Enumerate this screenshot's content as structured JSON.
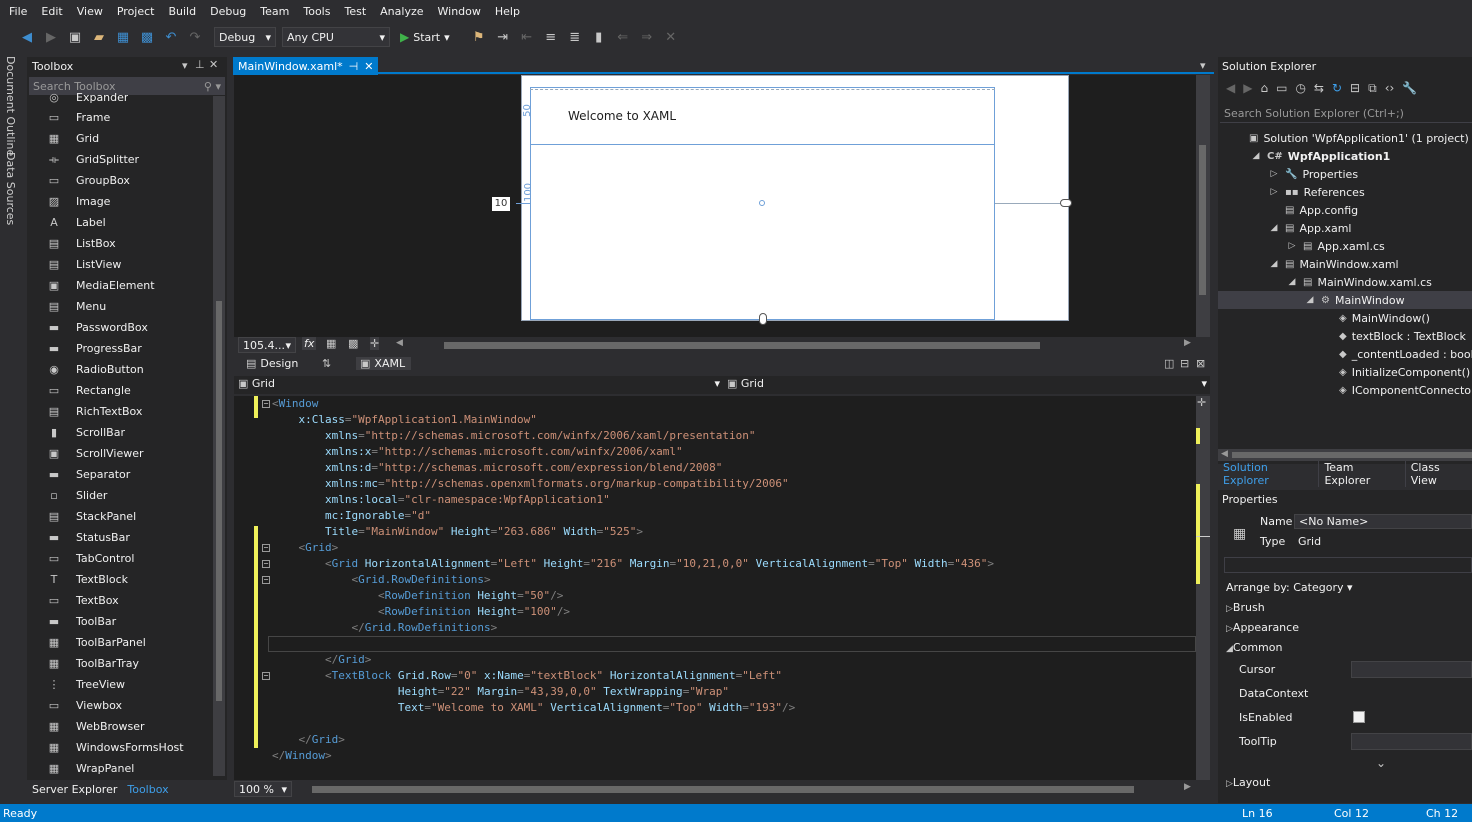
{
  "menu": [
    "File",
    "Edit",
    "View",
    "Project",
    "Build",
    "Debug",
    "Team",
    "Tools",
    "Test",
    "Analyze",
    "Window",
    "Help"
  ],
  "toolbar": {
    "config": "Debug",
    "platform": "Any CPU",
    "start": "Start"
  },
  "left_vtabs": [
    "Document Outline",
    "Data Sources"
  ],
  "toolbox": {
    "title": "Toolbox",
    "search": "Search Toolbox",
    "partial": "Expander",
    "items": [
      "Frame",
      "Grid",
      "GridSplitter",
      "GroupBox",
      "Image",
      "Label",
      "ListBox",
      "ListView",
      "MediaElement",
      "Menu",
      "PasswordBox",
      "ProgressBar",
      "RadioButton",
      "Rectangle",
      "RichTextBox",
      "ScrollBar",
      "ScrollViewer",
      "Separator",
      "Slider",
      "StackPanel",
      "StatusBar",
      "TabControl",
      "TextBlock",
      "TextBox",
      "ToolBar",
      "ToolBarPanel",
      "ToolBarTray",
      "TreeView",
      "Viewbox",
      "WebBrowser",
      "WindowsFormsHost",
      "WrapPanel"
    ],
    "bottom_tabs": [
      "Server Explorer",
      "Toolbox"
    ]
  },
  "doc_tab": {
    "label": "MainWindow.xaml*"
  },
  "designer": {
    "textblock": "Welcome to XAML",
    "row1": "50",
    "row2": "100",
    "margin_left": "10",
    "zoom": "105.4...",
    "fx": "fx"
  },
  "split": {
    "design": "Design",
    "xaml": "XAML",
    "arrows": "⇅"
  },
  "nav": {
    "left": "Grid",
    "right": "Grid"
  },
  "code_zoom": "100 %",
  "code": [
    [
      [
        "br",
        "<"
      ],
      [
        "tag",
        "Window"
      ]
    ],
    [
      [
        "txt",
        "    "
      ],
      [
        "attr",
        "x:Class"
      ],
      [
        "br",
        "="
      ],
      [
        "val",
        "\"WpfApplication1.MainWindow\""
      ]
    ],
    [
      [
        "txt",
        "        "
      ],
      [
        "attr",
        "xmlns"
      ],
      [
        "br",
        "="
      ],
      [
        "val",
        "\"http://schemas.microsoft.com/winfx/2006/xaml/presentation\""
      ]
    ],
    [
      [
        "txt",
        "        "
      ],
      [
        "attr",
        "xmlns:x"
      ],
      [
        "br",
        "="
      ],
      [
        "val",
        "\"http://schemas.microsoft.com/winfx/2006/xaml\""
      ]
    ],
    [
      [
        "txt",
        "        "
      ],
      [
        "attr",
        "xmlns:d"
      ],
      [
        "br",
        "="
      ],
      [
        "val",
        "\"http://schemas.microsoft.com/expression/blend/2008\""
      ]
    ],
    [
      [
        "txt",
        "        "
      ],
      [
        "attr",
        "xmlns:mc"
      ],
      [
        "br",
        "="
      ],
      [
        "val",
        "\"http://schemas.openxmlformats.org/markup-compatibility/2006\""
      ]
    ],
    [
      [
        "txt",
        "        "
      ],
      [
        "attr",
        "xmlns:local"
      ],
      [
        "br",
        "="
      ],
      [
        "val",
        "\"clr-namespace:WpfApplication1\""
      ]
    ],
    [
      [
        "txt",
        "        "
      ],
      [
        "attr",
        "mc:Ignorable"
      ],
      [
        "br",
        "="
      ],
      [
        "val",
        "\"d\""
      ]
    ],
    [
      [
        "txt",
        "        "
      ],
      [
        "attr",
        "Title"
      ],
      [
        "br",
        "="
      ],
      [
        "val",
        "\"MainWindow\""
      ],
      [
        "txt",
        " "
      ],
      [
        "attr",
        "Height"
      ],
      [
        "br",
        "="
      ],
      [
        "val",
        "\"263.686\""
      ],
      [
        "txt",
        " "
      ],
      [
        "attr",
        "Width"
      ],
      [
        "br",
        "="
      ],
      [
        "val",
        "\"525\""
      ],
      [
        "br",
        ">"
      ]
    ],
    [
      [
        "txt",
        "    "
      ],
      [
        "br",
        "<"
      ],
      [
        "tag",
        "Grid"
      ],
      [
        "br",
        ">"
      ]
    ],
    [
      [
        "txt",
        "        "
      ],
      [
        "br",
        "<"
      ],
      [
        "tag",
        "Grid"
      ],
      [
        "txt",
        " "
      ],
      [
        "attr",
        "HorizontalAlignment"
      ],
      [
        "br",
        "="
      ],
      [
        "val",
        "\"Left\""
      ],
      [
        "txt",
        " "
      ],
      [
        "attr",
        "Height"
      ],
      [
        "br",
        "="
      ],
      [
        "val",
        "\"216\""
      ],
      [
        "txt",
        " "
      ],
      [
        "attr",
        "Margin"
      ],
      [
        "br",
        "="
      ],
      [
        "val",
        "\"10,21,0,0\""
      ],
      [
        "txt",
        " "
      ],
      [
        "attr",
        "VerticalAlignment"
      ],
      [
        "br",
        "="
      ],
      [
        "val",
        "\"Top\""
      ],
      [
        "txt",
        " "
      ],
      [
        "attr",
        "Width"
      ],
      [
        "br",
        "="
      ],
      [
        "val",
        "\"436\""
      ],
      [
        "br",
        ">"
      ]
    ],
    [
      [
        "txt",
        "            "
      ],
      [
        "br",
        "<"
      ],
      [
        "tag",
        "Grid.RowDefinitions"
      ],
      [
        "br",
        ">"
      ]
    ],
    [
      [
        "txt",
        "                "
      ],
      [
        "br",
        "<"
      ],
      [
        "tag",
        "RowDefinition"
      ],
      [
        "txt",
        " "
      ],
      [
        "attr",
        "Height"
      ],
      [
        "br",
        "="
      ],
      [
        "val",
        "\"50\""
      ],
      [
        "br",
        "/>"
      ]
    ],
    [
      [
        "txt",
        "                "
      ],
      [
        "br",
        "<"
      ],
      [
        "tag",
        "RowDefinition"
      ],
      [
        "txt",
        " "
      ],
      [
        "attr",
        "Height"
      ],
      [
        "br",
        "="
      ],
      [
        "val",
        "\"100\""
      ],
      [
        "br",
        "/>"
      ]
    ],
    [
      [
        "txt",
        "            "
      ],
      [
        "br",
        "</"
      ],
      [
        "tag",
        "Grid.RowDefinitions"
      ],
      [
        "br",
        ">"
      ]
    ],
    [],
    [
      [
        "txt",
        "        "
      ],
      [
        "br",
        "</"
      ],
      [
        "tag",
        "Grid"
      ],
      [
        "br",
        ">"
      ]
    ],
    [
      [
        "txt",
        "        "
      ],
      [
        "br",
        "<"
      ],
      [
        "tag",
        "TextBlock"
      ],
      [
        "txt",
        " "
      ],
      [
        "attr",
        "Grid.Row"
      ],
      [
        "br",
        "="
      ],
      [
        "val",
        "\"0\""
      ],
      [
        "txt",
        " "
      ],
      [
        "attr",
        "x:Name"
      ],
      [
        "br",
        "="
      ],
      [
        "val",
        "\"textBlock\""
      ],
      [
        "txt",
        " "
      ],
      [
        "attr",
        "HorizontalAlignment"
      ],
      [
        "br",
        "="
      ],
      [
        "val",
        "\"Left\""
      ]
    ],
    [
      [
        "txt",
        "                   "
      ],
      [
        "attr",
        "Height"
      ],
      [
        "br",
        "="
      ],
      [
        "val",
        "\"22\""
      ],
      [
        "txt",
        " "
      ],
      [
        "attr",
        "Margin"
      ],
      [
        "br",
        "="
      ],
      [
        "val",
        "\"43,39,0,0\""
      ],
      [
        "txt",
        " "
      ],
      [
        "attr",
        "TextWrapping"
      ],
      [
        "br",
        "="
      ],
      [
        "val",
        "\"Wrap\""
      ]
    ],
    [
      [
        "txt",
        "                   "
      ],
      [
        "attr",
        "Text"
      ],
      [
        "br",
        "="
      ],
      [
        "val",
        "\"Welcome to XAML\""
      ],
      [
        "txt",
        " "
      ],
      [
        "attr",
        "VerticalAlignment"
      ],
      [
        "br",
        "="
      ],
      [
        "val",
        "\"Top\""
      ],
      [
        "txt",
        " "
      ],
      [
        "attr",
        "Width"
      ],
      [
        "br",
        "="
      ],
      [
        "val",
        "\"193\""
      ],
      [
        "br",
        "/>"
      ]
    ],
    [],
    [
      [
        "txt",
        "    "
      ],
      [
        "br",
        "</"
      ],
      [
        "tag",
        "Grid"
      ],
      [
        "br",
        ">"
      ]
    ],
    [
      [
        "br",
        "</"
      ],
      [
        "tag",
        "Window"
      ],
      [
        "br",
        ">"
      ]
    ]
  ],
  "solution_explorer": {
    "title": "Solution Explorer",
    "search": "Search Solution Explorer (Ctrl+;)",
    "items": [
      {
        "label": "Solution 'WpfApplication1' (1 project)",
        "arrow": "",
        "icon": "▣"
      },
      {
        "label": "WpfApplication1",
        "arrow": "◢",
        "icon": "C#",
        "bold": true
      },
      {
        "label": "Properties",
        "arrow": "▷",
        "icon": "🔧"
      },
      {
        "label": "References",
        "arrow": "▷",
        "icon": "▪▪"
      },
      {
        "label": "App.config",
        "arrow": "",
        "icon": "▤"
      },
      {
        "label": "App.xaml",
        "arrow": "◢",
        "icon": "▤"
      },
      {
        "label": "App.xaml.cs",
        "arrow": "▷",
        "icon": "▤"
      },
      {
        "label": "MainWindow.xaml",
        "arrow": "◢",
        "icon": "▤"
      },
      {
        "label": "MainWindow.xaml.cs",
        "arrow": "◢",
        "icon": "▤"
      },
      {
        "label": "MainWindow",
        "arrow": "◢",
        "icon": "⚙"
      },
      {
        "label": "MainWindow()",
        "arrow": "",
        "icon": "◈"
      },
      {
        "label": "textBlock : TextBlock",
        "arrow": "",
        "icon": "◆"
      },
      {
        "label": "_contentLoaded : bool",
        "arrow": "",
        "icon": "◆"
      },
      {
        "label": "InitializeComponent() : void",
        "arrow": "",
        "icon": "◈"
      },
      {
        "label": "IComponentConnector.Conne",
        "arrow": "",
        "icon": "◈"
      }
    ],
    "tabs": [
      "Solution Explorer",
      "Team Explorer",
      "Class View"
    ]
  },
  "properties": {
    "title": "Properties",
    "name_label": "Name",
    "name_value": "<No Name>",
    "type_label": "Type",
    "type_value": "Grid",
    "arrange": "Arrange by: Category ▾",
    "cats": [
      "Brush",
      "Appearance",
      "Common"
    ],
    "common": [
      "Cursor",
      "DataContext",
      "IsEnabled",
      "ToolTip"
    ],
    "layout": "Layout"
  },
  "status": {
    "ready": "Ready",
    "ln": "Ln 16",
    "col": "Col 12",
    "ch": "Ch 12"
  }
}
